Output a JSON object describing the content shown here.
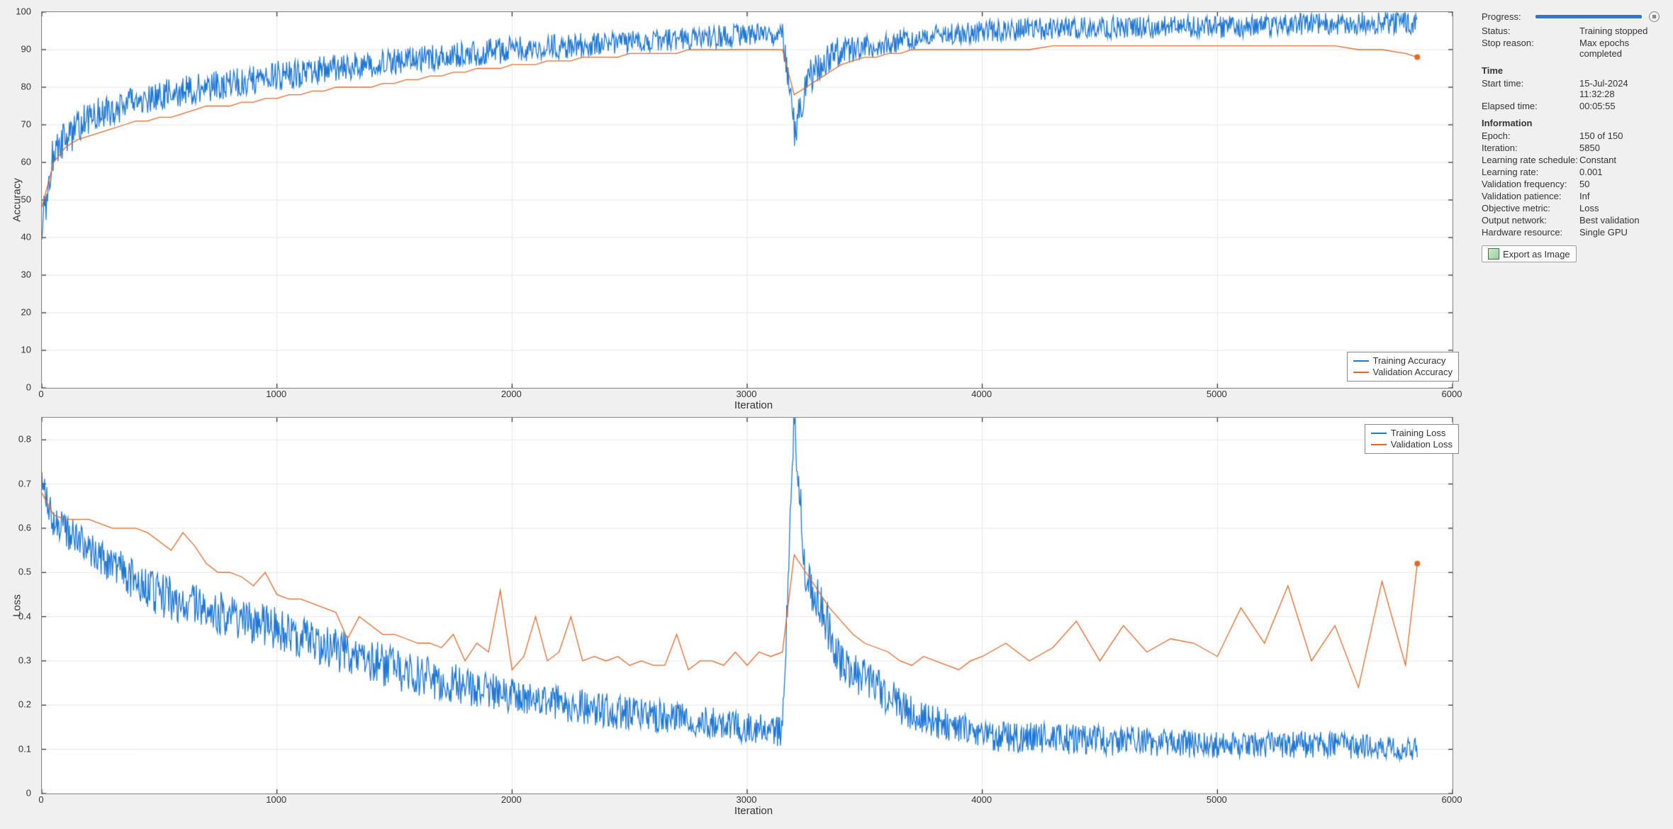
{
  "charts": {
    "xlabel": "Iteration",
    "xmax": 6000,
    "xticks": [
      0,
      1000,
      2000,
      3000,
      4000,
      5000,
      6000
    ]
  },
  "accuracy": {
    "ylabel": "Accuracy",
    "ymin": 0,
    "ymax": 100,
    "yticks": [
      0,
      10,
      20,
      30,
      40,
      50,
      60,
      70,
      80,
      90,
      100
    ],
    "legend_train": "Training Accuracy",
    "legend_val": "Validation Accuracy"
  },
  "loss": {
    "ylabel": "Loss",
    "ymin": 0,
    "ymax": 0.85,
    "yticks": [
      0,
      0.1,
      0.2,
      0.3,
      0.4,
      0.5,
      0.6,
      0.7,
      0.8
    ],
    "legend_train": "Training Loss",
    "legend_val": "Validation Loss"
  },
  "panel": {
    "progress_label": "Progress:",
    "status_label": "Status:",
    "status_value": "Training stopped",
    "stop_label": "Stop reason:",
    "stop_value": "Max epochs completed",
    "time_header": "Time",
    "start_label": "Start time:",
    "start_value": "15-Jul-2024 11:32:28",
    "elapsed_label": "Elapsed time:",
    "elapsed_value": "00:05:55",
    "info_header": "Information",
    "epoch_label": "Epoch:",
    "epoch_value": "150 of 150",
    "iter_label": "Iteration:",
    "iter_value": "5850",
    "lrs_label": "Learning rate schedule:",
    "lrs_value": "Constant",
    "lr_label": "Learning rate:",
    "lr_value": "0.001",
    "vfreq_label": "Validation frequency:",
    "vfreq_value": "50",
    "vpat_label": "Validation patience:",
    "vpat_value": "Inf",
    "obj_label": "Objective metric:",
    "obj_value": "Loss",
    "out_label": "Output network:",
    "out_value": "Best validation",
    "hw_label": "Hardware resource:",
    "hw_value": "Single GPU",
    "export_label": "Export as Image"
  },
  "colors": {
    "train": "#1f77d4",
    "val": "#e06a2b",
    "grid": "#e6e6e6",
    "axis": "#444",
    "tick": "#222"
  },
  "chart_data": [
    {
      "type": "line",
      "title": "Accuracy vs Iteration",
      "xlabel": "Iteration",
      "ylabel": "Accuracy",
      "xlim": [
        0,
        6000
      ],
      "ylim": [
        0,
        100
      ],
      "x_total_iters": 5850,
      "series": [
        {
          "name": "Training Accuracy",
          "kind": "dense-noisy",
          "color": "#1f77d4",
          "trend_x": [
            0,
            50,
            200,
            500,
            1000,
            1500,
            2000,
            2500,
            3000,
            3150,
            3200,
            3250,
            3400,
            3700,
            4000,
            4500,
            5000,
            5500,
            5850
          ],
          "trend_y": [
            43,
            63,
            72,
            78,
            83,
            87,
            90,
            92,
            94,
            94,
            68,
            82,
            90,
            93,
            95,
            96,
            96,
            97,
            97
          ],
          "noise_amp_y": [
            6,
            5,
            4.5,
            4,
            4,
            3.5,
            3.5,
            3,
            3,
            3,
            6,
            5,
            4,
            3,
            3,
            3,
            3,
            3,
            3
          ]
        },
        {
          "name": "Validation Accuracy",
          "kind": "sparse",
          "color": "#e06a2b",
          "end_marker": true,
          "x": [
            0,
            50,
            100,
            150,
            200,
            250,
            300,
            350,
            400,
            450,
            500,
            550,
            600,
            650,
            700,
            750,
            800,
            850,
            900,
            950,
            1000,
            1050,
            1100,
            1150,
            1200,
            1250,
            1300,
            1350,
            1400,
            1450,
            1500,
            1550,
            1600,
            1650,
            1700,
            1750,
            1800,
            1850,
            1900,
            1950,
            2000,
            2050,
            2100,
            2150,
            2200,
            2250,
            2300,
            2350,
            2400,
            2450,
            2500,
            2550,
            2600,
            2650,
            2700,
            2750,
            2800,
            2850,
            2900,
            2950,
            3000,
            3050,
            3100,
            3150,
            3200,
            3250,
            3300,
            3350,
            3400,
            3450,
            3500,
            3550,
            3600,
            3650,
            3700,
            3750,
            3800,
            3850,
            3900,
            3950,
            4000,
            4100,
            4200,
            4300,
            4400,
            4500,
            4600,
            4700,
            4800,
            4900,
            5000,
            5100,
            5200,
            5300,
            5400,
            5500,
            5600,
            5700,
            5800,
            5850
          ],
          "y": [
            48,
            60,
            64,
            66,
            67,
            68,
            69,
            70,
            71,
            71,
            72,
            72,
            73,
            74,
            75,
            75,
            75,
            76,
            76,
            77,
            77,
            78,
            78,
            79,
            79,
            80,
            80,
            80,
            80,
            81,
            81,
            82,
            82,
            83,
            83,
            84,
            84,
            85,
            85,
            85,
            86,
            86,
            86,
            87,
            87,
            87,
            88,
            88,
            88,
            88,
            89,
            89,
            89,
            89,
            89,
            90,
            90,
            90,
            90,
            90,
            90,
            90,
            90,
            90,
            78,
            80,
            82,
            84,
            86,
            87,
            88,
            88,
            89,
            89,
            90,
            90,
            90,
            90,
            90,
            90,
            90,
            90,
            90,
            91,
            91,
            91,
            91,
            91,
            91,
            91,
            91,
            91,
            91,
            91,
            91,
            91,
            90,
            90,
            89,
            88
          ]
        }
      ]
    },
    {
      "type": "line",
      "title": "Loss vs Iteration",
      "xlabel": "Iteration",
      "ylabel": "Loss",
      "xlim": [
        0,
        6000
      ],
      "ylim": [
        0,
        0.85
      ],
      "x_total_iters": 5850,
      "series": [
        {
          "name": "Training Loss",
          "kind": "dense-noisy",
          "color": "#1f77d4",
          "trend_x": [
            0,
            50,
            200,
            500,
            1000,
            1500,
            2000,
            2500,
            3000,
            3150,
            3200,
            3250,
            3400,
            3700,
            4000,
            4500,
            5000,
            5500,
            5850
          ],
          "trend_y": [
            0.7,
            0.62,
            0.55,
            0.45,
            0.37,
            0.28,
            0.22,
            0.18,
            0.15,
            0.14,
            0.85,
            0.5,
            0.3,
            0.18,
            0.13,
            0.12,
            0.11,
            0.11,
            0.1
          ],
          "noise_amp_y": [
            0.03,
            0.04,
            0.04,
            0.05,
            0.05,
            0.05,
            0.04,
            0.04,
            0.035,
            0.035,
            0.05,
            0.06,
            0.05,
            0.04,
            0.035,
            0.035,
            0.03,
            0.03,
            0.025
          ]
        },
        {
          "name": "Validation Loss",
          "kind": "sparse",
          "color": "#e06a2b",
          "end_marker": true,
          "x": [
            0,
            50,
            100,
            150,
            200,
            250,
            300,
            350,
            400,
            450,
            500,
            550,
            600,
            650,
            700,
            750,
            800,
            850,
            900,
            950,
            1000,
            1050,
            1100,
            1150,
            1200,
            1250,
            1300,
            1350,
            1400,
            1450,
            1500,
            1550,
            1600,
            1650,
            1700,
            1750,
            1800,
            1850,
            1900,
            1950,
            2000,
            2050,
            2100,
            2150,
            2200,
            2250,
            2300,
            2350,
            2400,
            2450,
            2500,
            2550,
            2600,
            2650,
            2700,
            2750,
            2800,
            2850,
            2900,
            2950,
            3000,
            3050,
            3100,
            3150,
            3200,
            3250,
            3300,
            3350,
            3400,
            3450,
            3500,
            3550,
            3600,
            3650,
            3700,
            3750,
            3800,
            3850,
            3900,
            3950,
            4000,
            4100,
            4200,
            4300,
            4400,
            4500,
            4600,
            4700,
            4800,
            4900,
            5000,
            5100,
            5200,
            5300,
            5400,
            5500,
            5600,
            5700,
            5800,
            5850
          ],
          "y": [
            0.68,
            0.63,
            0.62,
            0.62,
            0.62,
            0.61,
            0.6,
            0.6,
            0.6,
            0.59,
            0.57,
            0.55,
            0.59,
            0.56,
            0.52,
            0.5,
            0.5,
            0.49,
            0.47,
            0.5,
            0.45,
            0.44,
            0.44,
            0.43,
            0.42,
            0.41,
            0.35,
            0.4,
            0.38,
            0.36,
            0.36,
            0.35,
            0.34,
            0.34,
            0.33,
            0.36,
            0.3,
            0.34,
            0.32,
            0.46,
            0.28,
            0.31,
            0.4,
            0.3,
            0.32,
            0.4,
            0.3,
            0.31,
            0.3,
            0.31,
            0.29,
            0.3,
            0.29,
            0.29,
            0.36,
            0.28,
            0.3,
            0.3,
            0.29,
            0.32,
            0.29,
            0.32,
            0.31,
            0.32,
            0.54,
            0.5,
            0.46,
            0.42,
            0.39,
            0.36,
            0.34,
            0.33,
            0.32,
            0.3,
            0.29,
            0.31,
            0.3,
            0.29,
            0.28,
            0.3,
            0.31,
            0.34,
            0.3,
            0.33,
            0.39,
            0.3,
            0.38,
            0.32,
            0.35,
            0.34,
            0.31,
            0.42,
            0.34,
            0.47,
            0.3,
            0.38,
            0.24,
            0.48,
            0.29,
            0.52
          ]
        }
      ]
    }
  ]
}
